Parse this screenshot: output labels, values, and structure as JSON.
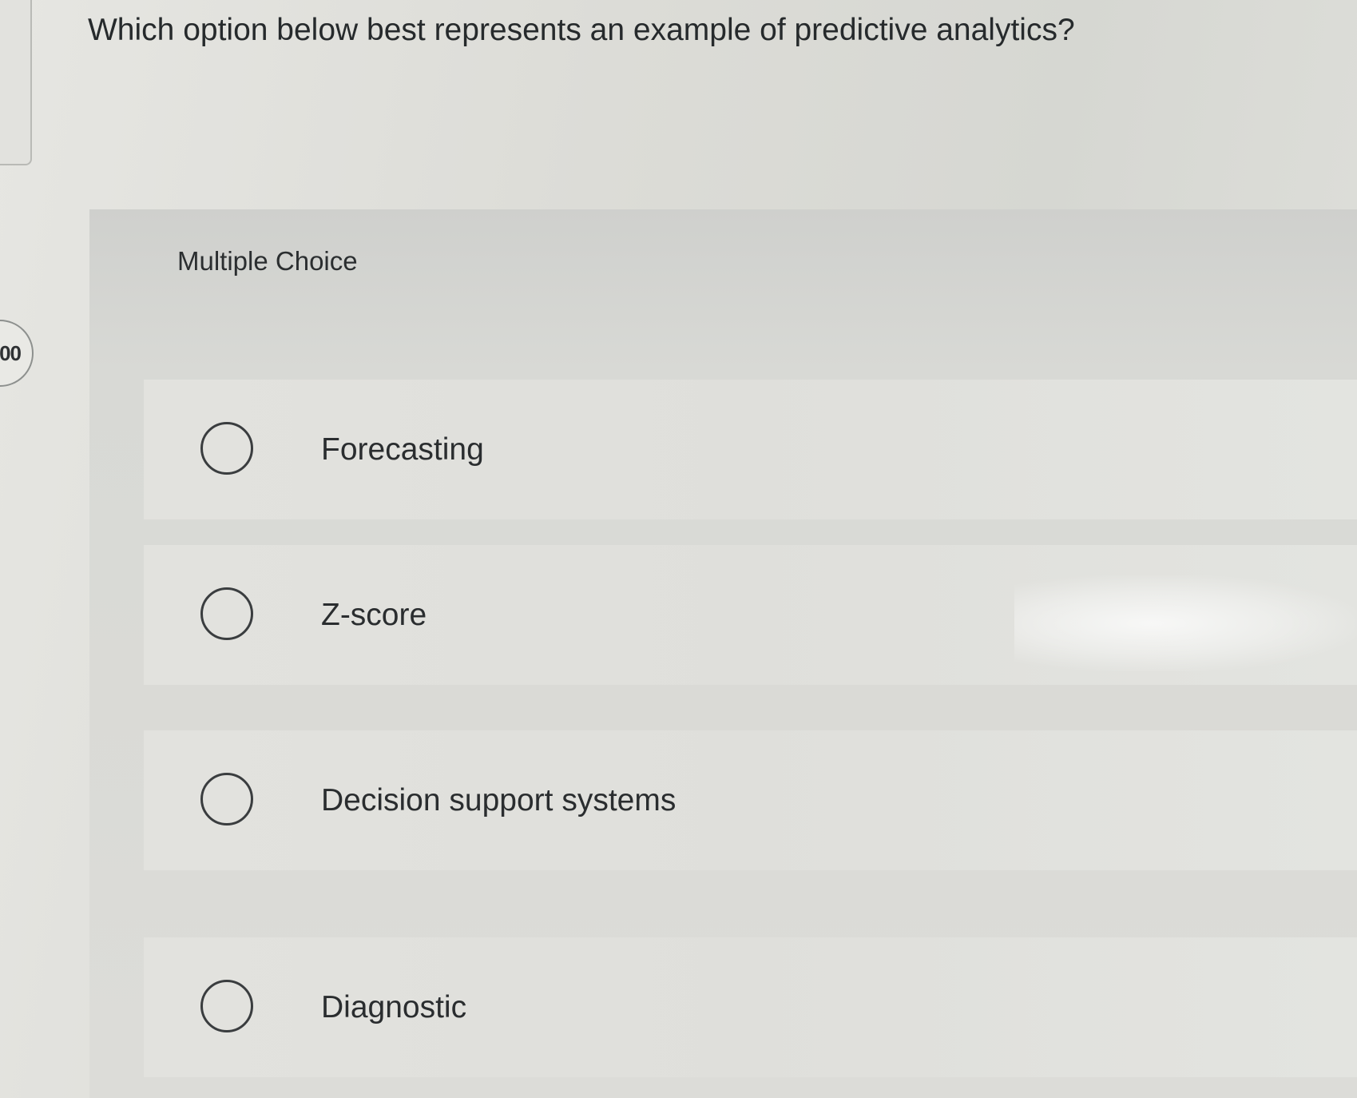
{
  "question": {
    "badge_text": "00",
    "text": "Which option below best represents an example of predictive analytics?"
  },
  "multiple_choice": {
    "label": "Multiple Choice",
    "options": [
      {
        "label": "Forecasting",
        "selected": false
      },
      {
        "label": "Z-score",
        "selected": false
      },
      {
        "label": "Decision support systems",
        "selected": false
      },
      {
        "label": "Diagnostic",
        "selected": false
      }
    ]
  },
  "colors": {
    "text": "#2a2d2f",
    "panel": "#dcdcd8",
    "radio_border": "#3a3d3f"
  }
}
